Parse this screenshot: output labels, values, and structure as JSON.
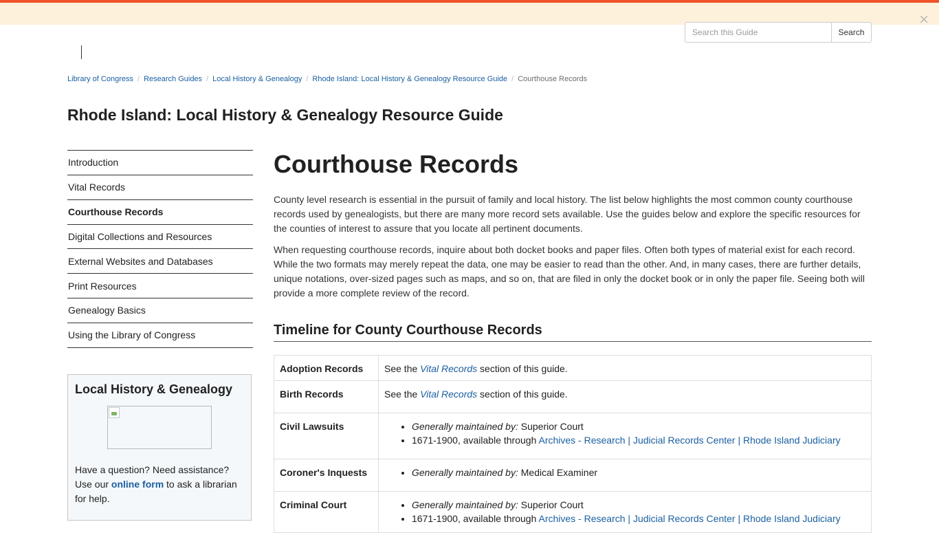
{
  "colors": {
    "accent_bar": "#f0522c",
    "alert_bg": "#fdf1dc",
    "link": "#1a5fa0",
    "sidebox_bg": "#f4f8fb"
  },
  "alert": {
    "close_icon": "×"
  },
  "search": {
    "placeholder": "Search this Guide",
    "button_label": "Search"
  },
  "breadcrumb": {
    "items": [
      "Library of Congress",
      "Research Guides",
      "Local History & Genealogy",
      "Rhode Island: Local History & Genealogy Resource Guide"
    ],
    "current": "Courthouse Records",
    "separator": "/"
  },
  "guide_title": "Rhode Island: Local History & Genealogy Resource Guide",
  "sidenav": {
    "items": [
      "Introduction",
      "Vital Records",
      "Courthouse Records",
      "Digital Collections and Resources",
      "External Websites and Databases",
      "Print Resources",
      "Genealogy Basics",
      "Using the Library of Congress"
    ],
    "active_index": 2
  },
  "sidebox": {
    "title": "Local History & Genealogy",
    "text_before": "Have a question? Need assistance? Use our ",
    "link_label": "online form",
    "text_after": " to ask a librarian for help."
  },
  "main": {
    "title": "Courthouse Records",
    "intro_1": "County level research is essential in the pursuit of family and local history. The list below highlights the most common county courthouse records used by genealogists, but there are many more record sets available. Use the guides below and explore the specific resources for the counties of interest to assure that you locate all pertinent documents.",
    "intro_2": "When requesting courthouse records, inquire about both docket books and paper files. Often both types of material exist for each record. While the two formats may merely repeat the data, one may be easier to read than the other. And, in many cases, there are further details, unique notations, over-sized pages such as maps, and so on, that are filed in only the docket book or in only the paper file. Seeing both will provide a more complete review of the record.",
    "section_title": "Timeline for County Courthouse Records"
  },
  "records": [
    {
      "type": "Adoption Records",
      "see_prefix": "See the ",
      "see_link": "Vital Records",
      "see_suffix": " section of this guide."
    },
    {
      "type": "Birth Records",
      "see_prefix": "See the ",
      "see_link": "Vital Records",
      "see_suffix": " section of this guide."
    },
    {
      "type": "Civil Lawsuits",
      "maintained_label": "Generally maintained by:",
      "maintained_by": " Superior Court",
      "range_text": "1671-1900, available through ",
      "range_link": "Archives - Research | Judicial Records Center | Rhode Island Judiciary"
    },
    {
      "type": "Coroner's Inquests",
      "maintained_label": "Generally maintained by:",
      "maintained_by": " Medical Examiner"
    },
    {
      "type": "Criminal Court",
      "maintained_label": "Generally maintained by:",
      "maintained_by": " Superior Court",
      "range_text": "1671-1900, available through ",
      "range_link": "Archives - Research | Judicial Records Center | Rhode Island Judiciary"
    }
  ]
}
